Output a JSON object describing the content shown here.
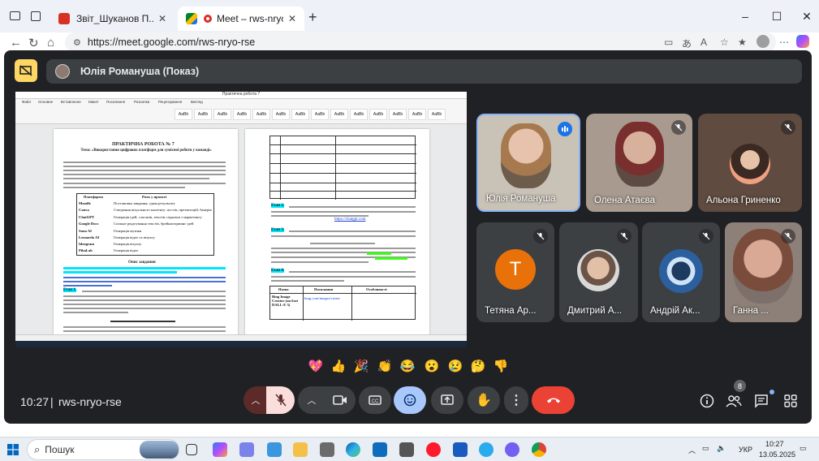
{
  "browser": {
    "tabs": [
      {
        "title": "Звіт_Шуканов П..pdf",
        "active": false
      },
      {
        "title": "Meet – rws-nryo-rse",
        "active": true
      }
    ],
    "url": "https://meet.google.com/rws-nryo-rse",
    "new_tab": "+",
    "colors": {
      "tab_strip": "#eef1f7",
      "pdf_icon": "#d93025"
    }
  },
  "meet": {
    "presenter_label": "Юлія Романуша (Показ)",
    "meeting_time": "10:27",
    "separator": "|",
    "meeting_code": "rws-nryo-rse",
    "participant_count": "8",
    "colors": {
      "background": "#202124",
      "mic_off": "#f9dedc",
      "end_call": "#ea4335",
      "active_control": "#a8c7fa",
      "present_badge": "#fdd663"
    }
  },
  "participants": [
    {
      "name": "Юлія Романуша",
      "state": "speaking"
    },
    {
      "name": "Олена Атаєва",
      "state": "muted"
    },
    {
      "name": "Альона Гриненко",
      "state": "muted"
    },
    {
      "name": "Тетяна Ар...",
      "state": "muted",
      "initial": "Т"
    },
    {
      "name": "Дмитрий А...",
      "state": "muted"
    },
    {
      "name": "Андрій Ак...",
      "state": "muted"
    },
    {
      "name": "Ганна ...",
      "state": "muted"
    }
  ],
  "reactions": [
    "💖",
    "👍",
    "🎉",
    "👏",
    "😂",
    "😮",
    "😢",
    "🤔",
    "👎"
  ],
  "shared_doc": {
    "page1": {
      "title": "ПРАКТИЧНА РОБОТА № 7",
      "subtitle": "Тема: «Використання цифрових платформ для сумісної роботи у команді»",
      "table_header": [
        "Платформа",
        "Роль у проєкті"
      ],
      "table_rows": [
        [
          "Moodle",
          "Постановка завдання, здача результату"
        ],
        [
          "Canva",
          "Створення візуального контенту: постів, презентацій, банерів"
        ],
        [
          "ChatGPT",
          "Генерація ідей, слоганів, текстів, підказки з маркетингу"
        ],
        [
          "Google Docs",
          "Спільне редагування текстів, брейншторминг ідей"
        ],
        [
          "Suno AI",
          "Генерація музики"
        ],
        [
          "Leonardo AI",
          "Генерація відео та візуалу"
        ],
        [
          "Ideogram",
          "Генерація візуалу"
        ],
        [
          "PikaLab",
          "Генерація відео"
        ]
      ],
      "section": "Опис завдання",
      "stage1": "Етап 1."
    },
    "page2": {
      "stage2": "Етап 2.",
      "link": "https://chatgpt.com",
      "stage3": "Етап 3.",
      "stage4": "Етап 4.",
      "table_header": [
        "Назва",
        "Посилання",
        "Особливості"
      ],
      "bing": "Bing Image Creator (на базі DALL·E 3)",
      "bing_link": "bing.com/images/create"
    }
  },
  "taskbar": {
    "search_placeholder": "Пошук",
    "lang": "УКР",
    "time": "10:27",
    "date": "13.05.2025"
  }
}
